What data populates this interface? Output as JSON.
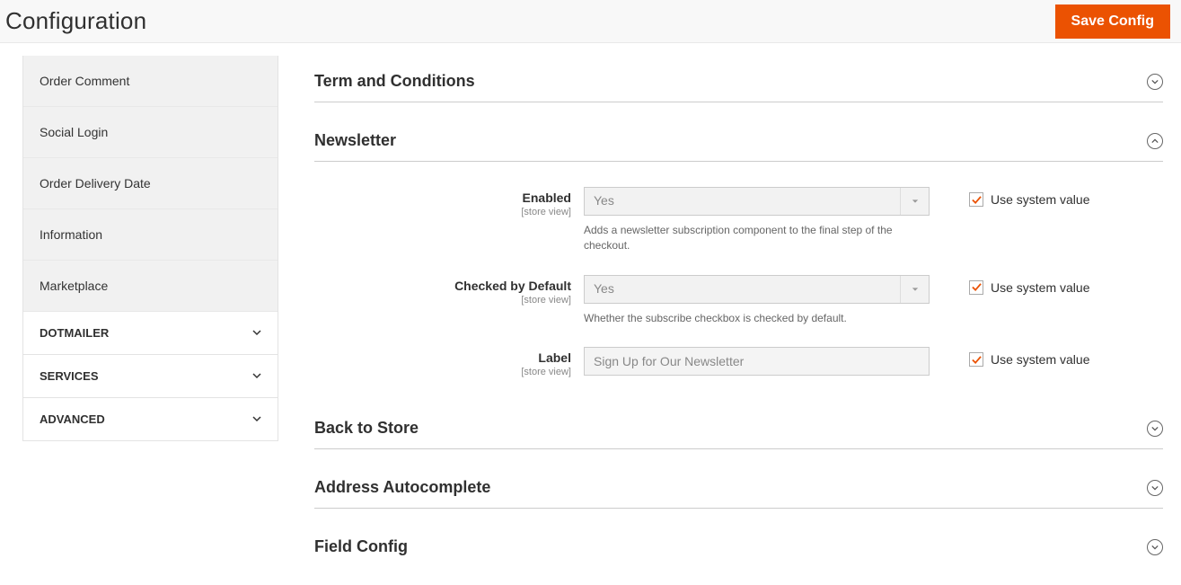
{
  "header": {
    "title": "Configuration",
    "save_label": "Save Config"
  },
  "sidebar": {
    "items": [
      {
        "label": "Order Comment"
      },
      {
        "label": "Social Login"
      },
      {
        "label": "Order Delivery Date"
      },
      {
        "label": "Information"
      },
      {
        "label": "Marketplace"
      }
    ],
    "groups": [
      {
        "label": "DOTMAILER"
      },
      {
        "label": "SERVICES"
      },
      {
        "label": "ADVANCED"
      }
    ]
  },
  "sections": {
    "terms": {
      "title": "Term and Conditions"
    },
    "newsletter": {
      "title": "Newsletter",
      "enabled": {
        "label": "Enabled",
        "scope": "[store view]",
        "value": "Yes",
        "hint": "Adds a newsletter subscription component to the final step of the checkout.",
        "use_system_label": "Use system value"
      },
      "checked": {
        "label": "Checked by Default",
        "scope": "[store view]",
        "value": "Yes",
        "hint": "Whether the subscribe checkbox is checked by default.",
        "use_system_label": "Use system value"
      },
      "label_field": {
        "label": "Label",
        "scope": "[store view]",
        "value": "Sign Up for Our Newsletter",
        "use_system_label": "Use system value"
      }
    },
    "back_to_store": {
      "title": "Back to Store"
    },
    "address_autocomplete": {
      "title": "Address Autocomplete"
    },
    "field_config": {
      "title": "Field Config"
    }
  }
}
